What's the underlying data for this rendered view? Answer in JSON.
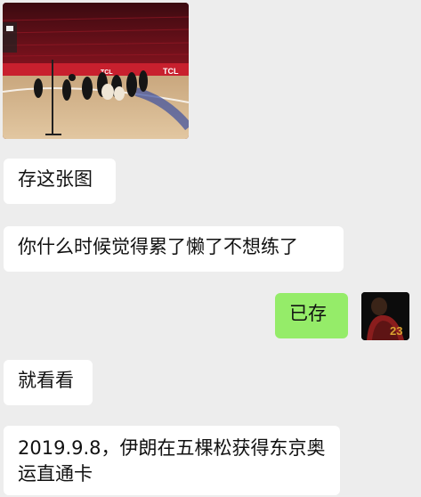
{
  "chat": {
    "messages": [
      {
        "sender": "other",
        "type": "image",
        "image_text": [
          "TCL",
          "TCL"
        ]
      },
      {
        "sender": "other",
        "type": "text",
        "text": "存这张图"
      },
      {
        "sender": "other",
        "type": "text",
        "text": "你什么时候觉得累了懒了不想练了"
      },
      {
        "sender": "me",
        "type": "text",
        "text": "已存"
      },
      {
        "sender": "other",
        "type": "text",
        "text": "就看看"
      },
      {
        "sender": "other",
        "type": "text",
        "text": "2019.9.8，伊朗在五棵松获得东京奥运直通卡"
      }
    ],
    "avatar": {
      "jersey_number": "23"
    }
  },
  "colors": {
    "background": "#ededed",
    "received_bubble": "#ffffff",
    "sent_bubble": "#95ec69"
  }
}
